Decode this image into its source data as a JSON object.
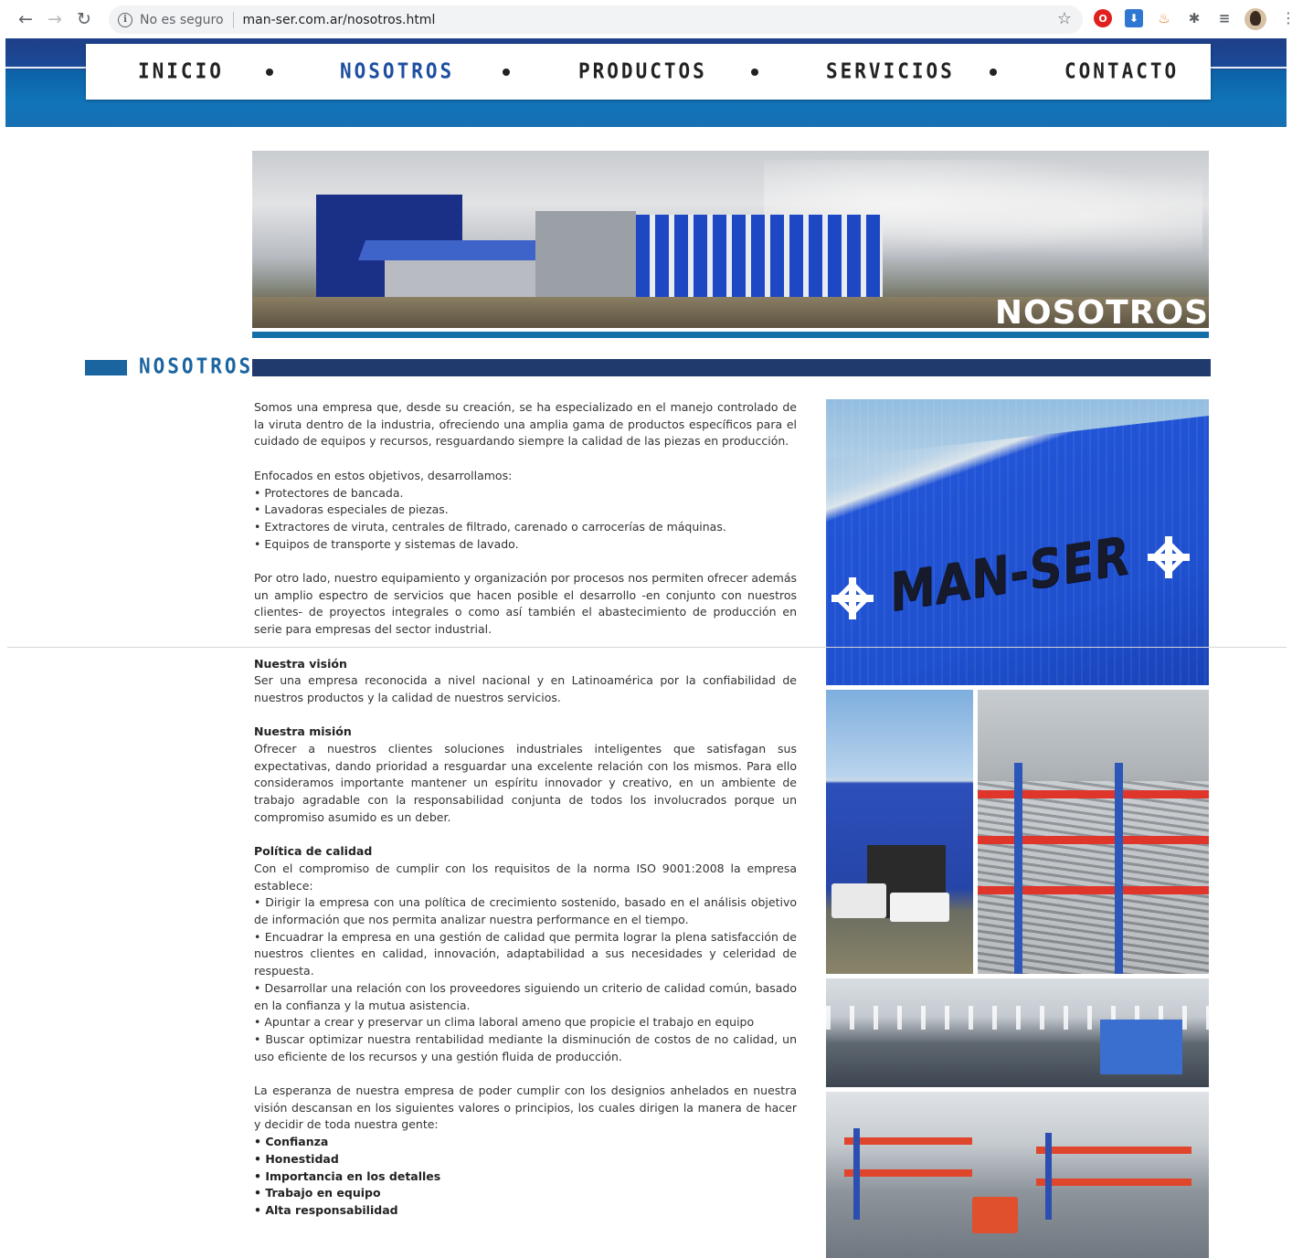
{
  "browser": {
    "security_label": "No es seguro",
    "url": "man-ser.com.ar/nosotros.html"
  },
  "menu": {
    "items": [
      {
        "label": "INICIO",
        "active": false
      },
      {
        "label": "NOSOTROS",
        "active": true
      },
      {
        "label": "PRODUCTOS",
        "active": false
      },
      {
        "label": "SERVICIOS",
        "active": false
      },
      {
        "label": "CONTACTO",
        "active": false
      }
    ]
  },
  "hero": {
    "title": "NOSOTROS"
  },
  "section": {
    "title": "NOSOTROS"
  },
  "photos": {
    "logo_text": "MAN-SER"
  },
  "content": {
    "intro": "Somos una empresa que, desde su creación, se ha especializado en el manejo controlado de la viruta dentro de la industria, ofreciendo una amplia gama de productos específicos para el cuidado de equipos y recursos, resguardando siempre la calidad de las piezas en producción.",
    "focus_title": "Enfocados en estos objetivos, desarrollamos:",
    "focus_items": [
      "• Protectores de bancada.",
      "• Lavadoras especiales de piezas.",
      "• Extractores de viruta, centrales de filtrado, carenado o carrocerías de máquinas.",
      "• Equipos de transporte y sistemas de lavado."
    ],
    "services": "Por otro lado, nuestro equipamiento y organización por procesos nos permiten ofrecer además un amplio espectro de servicios que hacen posible el desarrollo -en conjunto con nuestros clientes- de proyectos integrales o como así también el abastecimiento de producción en serie para empresas del sector industrial.",
    "vision_title": "Nuestra visión",
    "vision": "Ser una empresa reconocida a nivel nacional y en Latinoamérica por la confiabilidad de nuestros productos y la calidad de nuestros servicios.",
    "mission_title": "Nuestra misión",
    "mission": "Ofrecer a nuestros clientes soluciones industriales inteligentes que satisfagan sus expectativas, dando prioridad a resguardar una excelente relación con los mismos. Para ello consideramos importante mantener un espíritu innovador y creativo, en un ambiente de trabajo agradable con la responsabilidad conjunta de todos los involucrados porque un compromiso asumido es un deber.",
    "quality_title": "Política de calidad",
    "quality_intro": "Con el compromiso de cumplir con los requisitos de la norma ISO 9001:2008 la empresa establece:",
    "quality_items": [
      "• Dirigir la empresa con una política de crecimiento sostenido, basado en el análisis objetivo de información que nos permita analizar nuestra performance en el tiempo.",
      "• Encuadrar la empresa en una gestión de calidad que permita lograr la plena satisfacción de nuestros clientes en calidad, innovación, adaptabilidad a sus necesidades y celeridad de respuesta.",
      "• Desarrollar una relación con los proveedores siguiendo un criterio de calidad común, basado en la confianza y la mutua asistencia.",
      "• Apuntar a crear y preservar un clima laboral ameno que propicie el trabajo en equipo",
      "• Buscar optimizar nuestra rentabilidad mediante la disminución de costos de no calidad, un uso eficiente de los recursos y una gestión fluida de producción."
    ],
    "values_intro": "La esperanza de nuestra empresa de poder cumplir con los designios anhelados en nuestra visión descansan en los siguientes valores o principios, los cuales dirigen la manera de hacer y decidir de toda nuestra gente:",
    "values": [
      "• Confianza",
      "• Honestidad",
      "• Importancia en los detalles",
      "• Trabajo en equipo",
      "• Alta responsabilidad"
    ]
  }
}
